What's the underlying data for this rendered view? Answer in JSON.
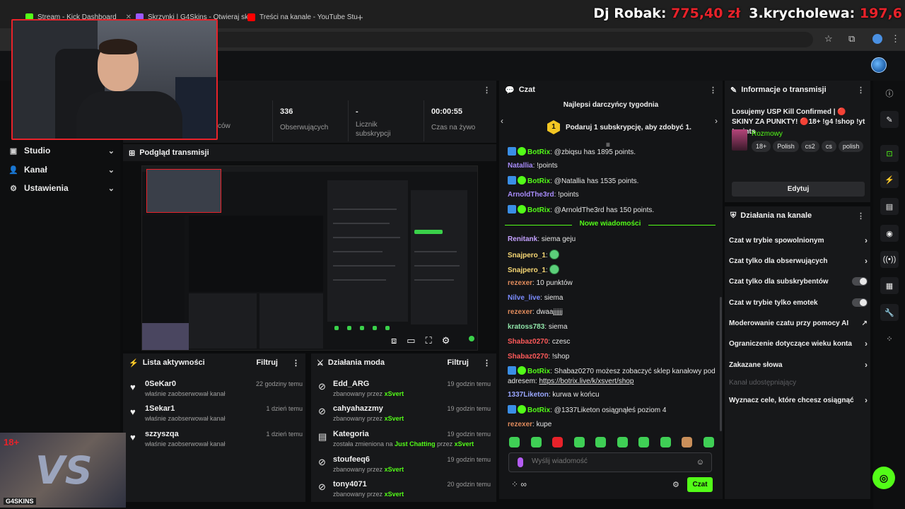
{
  "browser": {
    "tabs": [
      {
        "title": "Stream - Kick Dashboard",
        "color": "#53fc18"
      },
      {
        "title": "Skrzynki | G4Skins - Otwieraj sk",
        "color": "#9b59ff"
      },
      {
        "title": "Treści na kanale - YouTube Stu",
        "color": "#ff0000"
      }
    ],
    "new_tab": "+"
  },
  "overlay": {
    "name1": "Dj Robak:",
    "amount1": "775,40 zł",
    "name2": "3.krycholewa:",
    "amount2": "197,6"
  },
  "sidebar": {
    "items": [
      {
        "label": "Studio",
        "icon": "camera-icon"
      },
      {
        "label": "Kanał",
        "icon": "user-icon"
      },
      {
        "label": "Ustawienia",
        "icon": "gear-icon"
      }
    ]
  },
  "stats": {
    "partial_label": "ców",
    "followers_value": "336",
    "followers_label": "Obserwujących",
    "subs_value": "-",
    "subs_label": "Licznik subskrypcji",
    "live_value": "00:00:55",
    "live_label": "Czas na żywo"
  },
  "preview": {
    "title": "Podgląd transmisji"
  },
  "activity": {
    "title": "Lista aktywności",
    "filter": "Filtruj",
    "items": [
      {
        "name": "0SeKar0",
        "sub": "właśnie zaobserwował kanał",
        "time": "22 godziny temu"
      },
      {
        "name": "1Sekar1",
        "sub": "właśnie zaobserwował kanał",
        "time": "1 dzień temu"
      },
      {
        "name": "szzyszqa",
        "sub": "właśnie zaobserwował kanał",
        "time": "1 dzień temu"
      }
    ]
  },
  "mod": {
    "title": "Działania moda",
    "filter": "Filtruj",
    "items": [
      {
        "name": "Edd_ARG",
        "pre": "zbanowany przez",
        "mid": "",
        "by": "xSvert",
        "time": "19 godzin temu"
      },
      {
        "name": "cahyahazzmy",
        "pre": "zbanowany przez",
        "mid": "",
        "by": "xSvert",
        "time": "19 godzin temu"
      },
      {
        "name": "Kategoria",
        "pre": "została zmieniona na",
        "mid": "Just Chatting",
        "post": "przez",
        "by": "xSvert",
        "time": "19 godzin temu"
      },
      {
        "name": "stoufeeq6",
        "pre": "zbanowany przez",
        "mid": "",
        "by": "xSvert",
        "time": "19 godzin temu"
      },
      {
        "name": "tony4071",
        "pre": "zbanowany przez",
        "mid": "",
        "by": "xSvert",
        "time": "20 godzin temu"
      }
    ]
  },
  "chat": {
    "title": "Czat",
    "top_donors": "Najlepsi darczyńcy tygodnia",
    "rank": "1",
    "donor_prompt": "Podaruj 1 subskrypcję, aby zdobyć 1.",
    "new_messages": "Nowe wiadomości",
    "messages": [
      {
        "user": "BotRix",
        "color": "#53fc18",
        "badges": true,
        "text": "@zbiqsu has 1895 points."
      },
      {
        "user": "Natallia",
        "color": "#a78bfa",
        "text": "!points"
      },
      {
        "user": "BotRix",
        "color": "#53fc18",
        "badges": true,
        "text": "@Natallia has 1535 points."
      },
      {
        "user": "ArnoldThe3rd",
        "color": "#a78bfa",
        "text": "!points"
      },
      {
        "user": "BotRix",
        "color": "#53fc18",
        "badges": true,
        "text": "@ArnoldThe3rd has 150 points."
      },
      {
        "user": "Renitank",
        "color": "#c4a1ff",
        "text": "siema geju"
      },
      {
        "user": "Snajpero_1",
        "color": "#f7d774",
        "emote": true,
        "text": ""
      },
      {
        "user": "Snajpero_1",
        "color": "#f7d774",
        "emote": true,
        "text": ""
      },
      {
        "user": "rezexer",
        "color": "#e08b5c",
        "text": "10 punktów"
      },
      {
        "user": "Nilve_live",
        "color": "#7b8cff",
        "text": "siema"
      },
      {
        "user": "rezexer",
        "color": "#e08b5c",
        "text": "dwaajjjjjj"
      },
      {
        "user": "kratoss783",
        "color": "#8fe3a8",
        "text": "siema"
      },
      {
        "user": "Shabaz0270",
        "color": "#ff5a5a",
        "text": "czesc"
      },
      {
        "user": "Shabaz0270",
        "color": "#ff5a5a",
        "text": "!shop"
      },
      {
        "user": "BotRix",
        "color": "#53fc18",
        "badges": true,
        "text": "Shabaz0270 możesz zobaczyć sklep kanałowy pod adresem: ",
        "link": "https://botrix.live/k/xsvert/shop"
      },
      {
        "user": "1337Liketon",
        "color": "#9aa7ff",
        "text": "kurwa w końcu"
      },
      {
        "user": "BotRix",
        "color": "#53fc18",
        "badges": true,
        "text": "@1337Liketon osiągnąłeś poziom 4"
      },
      {
        "user": "rezexer",
        "color": "#e08b5c",
        "text": "kupe"
      }
    ],
    "input_placeholder": "Wyślij wiadomość",
    "send": "Czat"
  },
  "info": {
    "title": "Informacje o transmisji",
    "stream_title": "Losujemy USP Kill Confirmed | 🔴 SKINY ZA PUNKTY! 🔴18+ !g4 !shop !yt !points",
    "category": "Rozmowy",
    "tags": [
      "18+",
      "Polish",
      "cs2",
      "cs",
      "polish"
    ],
    "edit": "Edytuj"
  },
  "channel_actions": {
    "title": "Działania na kanale",
    "items": [
      {
        "label": "Czat w trybie spowolnionym",
        "kind": "chevron"
      },
      {
        "label": "Czat tylko dla obserwujących",
        "kind": "chevron"
      },
      {
        "label": "Czat tylko dla subskrybentów",
        "kind": "toggle"
      },
      {
        "label": "Czat w trybie tylko emotek",
        "kind": "toggle"
      },
      {
        "label": "Moderowanie czatu przy pomocy AI",
        "kind": "external"
      },
      {
        "label": "Ograniczenie dotyczące wieku konta",
        "kind": "chevron"
      },
      {
        "label": "Zakazane słowa",
        "kind": "chevron"
      },
      {
        "label": "Kanał udostępniający",
        "kind": "dim"
      },
      {
        "label": "Wyznacz cele, które chcesz osiągnąć",
        "kind": "chevron"
      }
    ]
  },
  "promo": {
    "age": "18+",
    "brand": "G4SKINS",
    "vs": "VS"
  },
  "accent": "#53fc18",
  "alert": "#e8222a"
}
